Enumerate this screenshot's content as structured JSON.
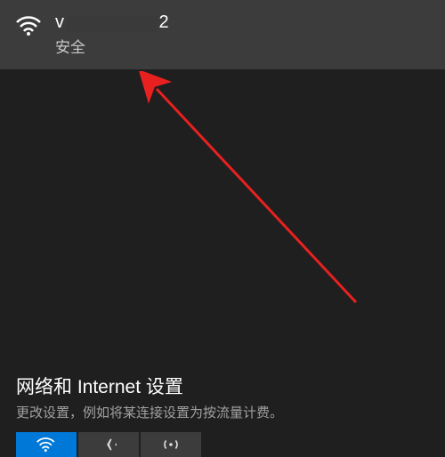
{
  "network": {
    "name_prefix": "v",
    "name_suffix": "2",
    "status": "安全"
  },
  "settings": {
    "title": "网络和 Internet 设置",
    "description": "更改设置，例如将某连接设置为按流量计费。"
  },
  "colors": {
    "accent": "#0078d7",
    "panel": "#3c3c3c",
    "bg": "#1f1f1f"
  }
}
